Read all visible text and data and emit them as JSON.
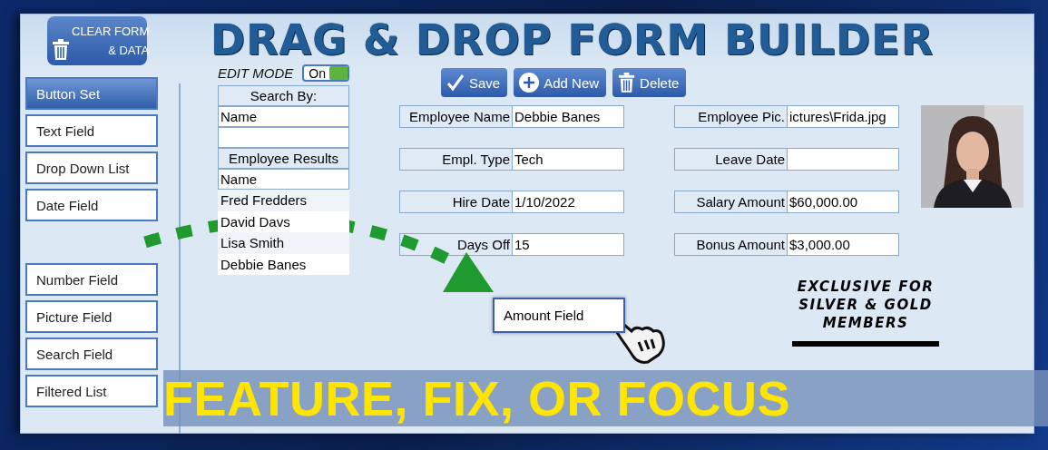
{
  "clear_button": {
    "label": "CLEAR FORM\n& DATA"
  },
  "title": "DRAG & DROP FORM BUILDER",
  "toolbox_groups": [
    [
      {
        "label": "Button Set",
        "selected": true
      },
      {
        "label": "Text Field",
        "selected": false
      },
      {
        "label": "Drop Down List",
        "selected": false
      },
      {
        "label": "Date Field",
        "selected": false
      }
    ],
    [
      {
        "label": "Number Field",
        "selected": false
      },
      {
        "label": "Picture Field",
        "selected": false
      },
      {
        "label": "Search Field",
        "selected": false
      },
      {
        "label": "Filtered List",
        "selected": false
      }
    ]
  ],
  "edit_mode": {
    "label": "EDIT MODE",
    "toggle_text": "On",
    "on": true
  },
  "search_panel": {
    "header": "Search By:",
    "search_by": "Name",
    "results_header": "Employee Results",
    "column": "Name",
    "results": [
      "Fred Fredders",
      "David Davs",
      "Lisa Smith",
      "Debbie Banes"
    ]
  },
  "actions": [
    {
      "label": "Save",
      "kind": "save"
    },
    {
      "label": "Add New",
      "kind": "add"
    },
    {
      "label": "Delete",
      "kind": "delete"
    }
  ],
  "fields_left": [
    {
      "label": "Employee Name",
      "value": "Debbie Banes"
    },
    {
      "label": "Empl. Type",
      "value": "Tech"
    },
    {
      "label": "Hire Date",
      "value": "1/10/2022"
    },
    {
      "label": "Days Off",
      "value": "15"
    }
  ],
  "fields_right": [
    {
      "label": "Employee Pic.",
      "value": "ictures\\Frida.jpg"
    },
    {
      "label": "Leave Date"
    },
    {
      "label": "Salary Amount",
      "value": "$60,000.00"
    },
    {
      "label": "Bonus Amount",
      "value": "$3,000.00"
    }
  ],
  "promo": "EXCLUSIVE FOR\nSILVER & GOLD\nMEMBERS",
  "dragged_field": {
    "label": "Amount Field"
  },
  "banner": "FEATURE, FIX, OR FOCUS"
}
